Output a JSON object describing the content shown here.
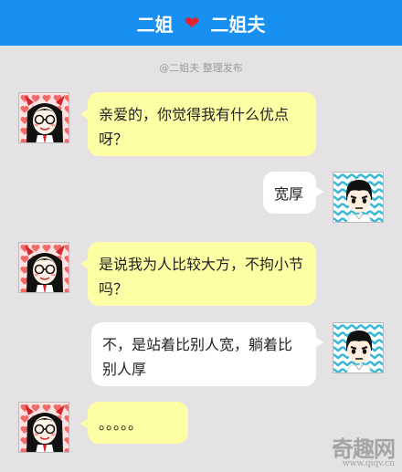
{
  "header": {
    "left_name": "二姐",
    "heart": "❤",
    "right_name": "二姐夫"
  },
  "credit": "@二姐夫 整理发布",
  "messages": [
    {
      "side": "left",
      "text": "亲爱的，你觉得我有什么优点呀？"
    },
    {
      "side": "right",
      "text": "宽厚"
    },
    {
      "side": "left",
      "text": "是说我为人比较大方，不拘小节吗？"
    },
    {
      "side": "right",
      "text": "不，是站着比别人宽，躺着比别人厚"
    },
    {
      "side": "left",
      "text": "。。。。。"
    }
  ],
  "watermark": {
    "main": "奇趣网",
    "sub": "www.qiqv.cn"
  },
  "colors": {
    "header": "#1790f2",
    "background": "#e4e2e4",
    "girl_bubble": "#feffa4",
    "boy_bubble": "#ffffff",
    "heart": "#e8212e"
  }
}
